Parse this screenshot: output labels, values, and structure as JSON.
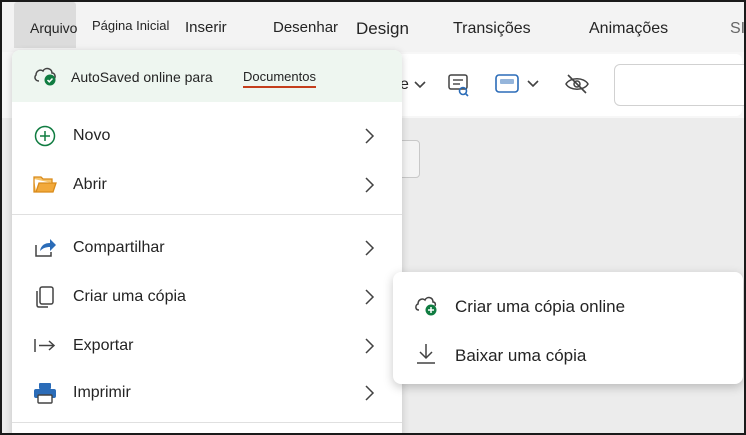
{
  "ribbon": {
    "tabs": {
      "arquivo": "Arquivo",
      "pagina_inicial": "Página Inicial",
      "inserir": "Inserir",
      "desenhar": "Desenhar",
      "design": "Design",
      "transicoes": "Transições",
      "animacoes": "Animações",
      "overflow": "SI"
    }
  },
  "toolbar": {
    "partial_text": "e"
  },
  "file_menu": {
    "autosave": {
      "text": "AutoSaved online para",
      "location": "Documentos",
      "icon": "cloud-check-icon"
    },
    "items": [
      {
        "label": "Novo",
        "icon": "plus-circle-icon"
      },
      {
        "label": "Abrir",
        "icon": "folder-open-icon"
      },
      {
        "label": "Compartilhar",
        "icon": "share-icon"
      },
      {
        "label": "Criar uma cópia",
        "icon": "copy-icon"
      },
      {
        "label": "Exportar",
        "icon": "export-arrow-icon"
      },
      {
        "label": "Imprimir",
        "icon": "printer-icon"
      }
    ]
  },
  "submenu": {
    "items": [
      {
        "label": "Criar uma cópia online",
        "icon": "cloud-add-icon"
      },
      {
        "label": "Baixar uma cópia",
        "icon": "download-icon"
      }
    ]
  },
  "colors": {
    "accent_red": "#c43e1c",
    "green": "#107c41",
    "folder": "#f2a93b",
    "printer_blue": "#2b6cb8"
  }
}
